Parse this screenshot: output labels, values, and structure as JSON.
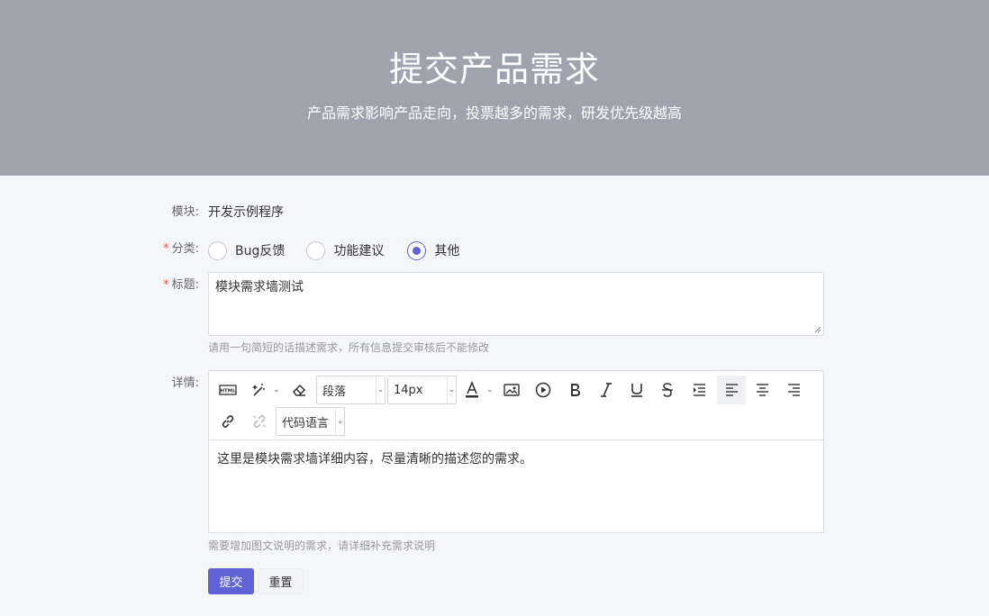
{
  "hero": {
    "title": "提交产品需求",
    "subtitle": "产品需求影响产品走向，投票越多的需求，研发优先级越高"
  },
  "form": {
    "module": {
      "label": "模块:",
      "value": "开发示例程序"
    },
    "category": {
      "label": "分类:",
      "required": "*",
      "options": [
        {
          "label": "Bug反馈",
          "checked": false
        },
        {
          "label": "功能建议",
          "checked": false
        },
        {
          "label": "其他",
          "checked": true
        }
      ]
    },
    "title": {
      "label": "标题:",
      "required": "*",
      "value": "模块需求墙测试",
      "hint": "请用一句简短的话描述需求，所有信息提交审核后不能修改"
    },
    "detail": {
      "label": "详情:",
      "content": "这里是模块需求墙详细内容，尽量清晰的描述您的需求。",
      "hint": "需要增加图文说明的需求，请详细补充需求说明",
      "toolbar": {
        "paragraph_select": "段落",
        "font_size_select": "14px",
        "code_lang_select": "代码语言",
        "active_tool": "align-left"
      }
    },
    "buttons": {
      "submit": "提交",
      "reset": "重置"
    }
  },
  "colors": {
    "hero_bg": "#9ea3ae",
    "accent": "#5f63d6",
    "required": "#e5584f"
  }
}
